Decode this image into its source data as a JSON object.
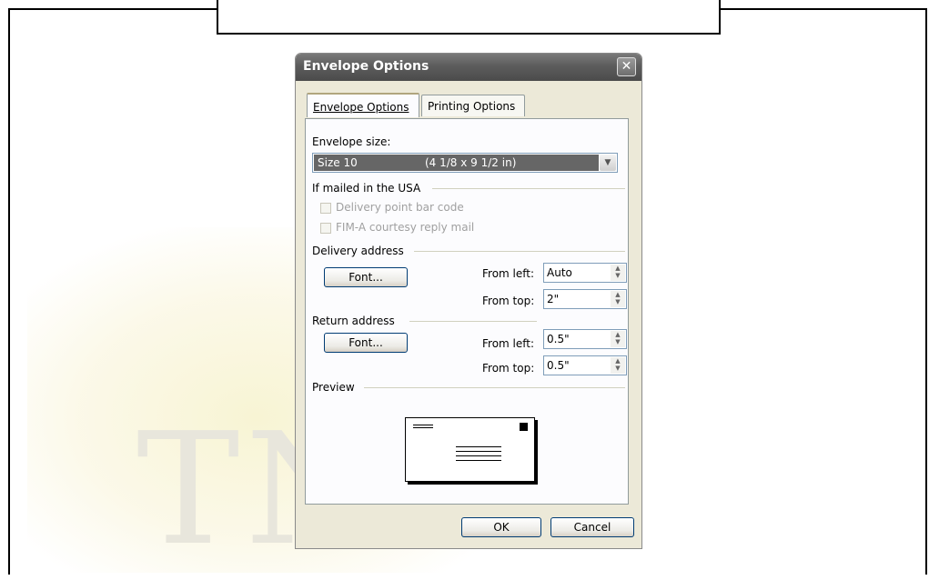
{
  "dialog": {
    "title": "Envelope Options",
    "close_glyph": "✕",
    "tabs": [
      "Envelope Options",
      "Printing Options"
    ],
    "envelope_size_label": "Envelope size:",
    "envelope_size_name": "Size 10",
    "envelope_size_dims": "(4 1/8 x 9 1/2 in)",
    "usa_group": "If mailed in the USA",
    "delivery_barcode": "Delivery point bar code",
    "fim_mail": "FIM-A courtesy reply mail",
    "delivery_group": "Delivery address",
    "delivery_font_button": "Font...",
    "from_left_label": "From left:",
    "from_top_label": "From top:",
    "delivery_from_left": "Auto",
    "delivery_from_top": "2\"",
    "return_group": "Return address",
    "return_font_button": "Font...",
    "return_from_left": "0.5\"",
    "return_from_top": "0.5\"",
    "preview_group": "Preview",
    "ok_button": "OK",
    "cancel_button": "Cancel"
  },
  "icons": {
    "close": "close-icon",
    "dropdown": "chevron-down-icon",
    "spinner": "spinner-arrows-icon",
    "envelope": "envelope-preview-icon"
  },
  "colors": {
    "titlebar": "#5c5c5c",
    "dialog_bg": "#ece9d8",
    "selection": "#666666"
  }
}
